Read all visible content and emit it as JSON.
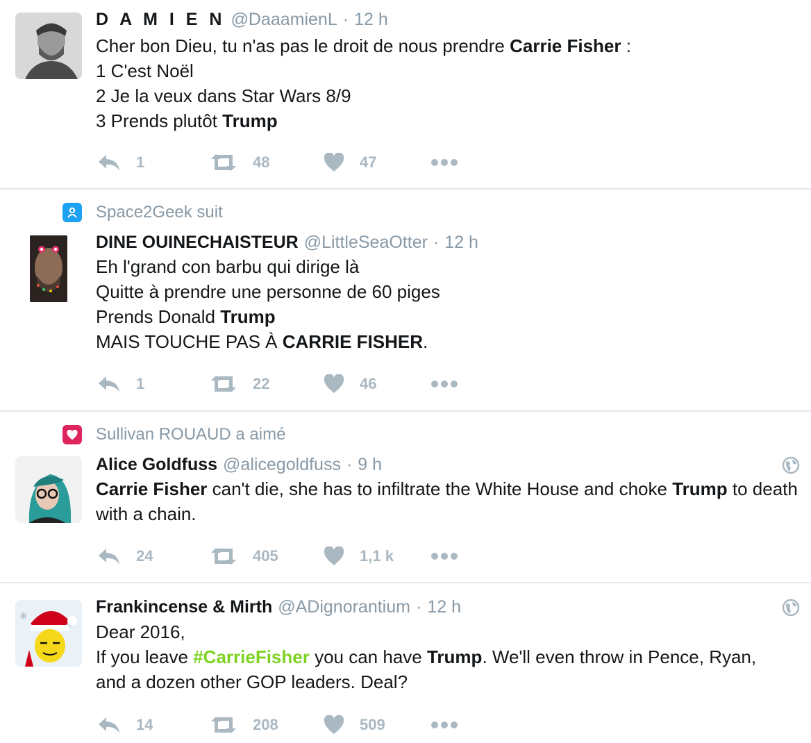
{
  "accent_color": "#1da1f2",
  "hashtag_color": "#7ed321",
  "tweets": [
    {
      "context": null,
      "author": {
        "name": "D A M I E N",
        "handle": "@DaaamienL",
        "time": "12 h",
        "avatar": "grayscale-man-portrait"
      },
      "body_lines": [
        [
          {
            "text": "Cher bon Dieu, tu n'as pas le droit de nous prendre "
          },
          {
            "text": "Carrie Fisher",
            "bold": true
          },
          {
            "text": " :"
          }
        ],
        [
          {
            "text": "1 C'est Noël"
          }
        ],
        [
          {
            "text": "2 Je la veux dans Star Wars 8/9"
          }
        ],
        [
          {
            "text": "3 Prends plutôt "
          },
          {
            "text": "Trump",
            "bold": true
          }
        ]
      ],
      "stats": {
        "replies": "1",
        "retweets": "48",
        "likes": "47"
      },
      "globe": false
    },
    {
      "context": {
        "icon": "follow-icon",
        "text": "Space2Geek suit"
      },
      "author": {
        "name": "DINE OUINECHAISTEUR",
        "handle": "@LittleSeaOtter",
        "time": "12 h",
        "avatar": "snapchat-filter-face"
      },
      "body_lines": [
        [
          {
            "text": "Eh l'grand con barbu qui dirige là"
          }
        ],
        [
          {
            "text": "Quitte à prendre une personne de 60 piges"
          }
        ],
        [
          {
            "text": "Prends Donald "
          },
          {
            "text": "Trump",
            "bold": true
          }
        ],
        [
          {
            "text": "MAIS TOUCHE PAS À "
          },
          {
            "text": "CARRIE FISHER",
            "bold": true
          },
          {
            "text": "."
          }
        ]
      ],
      "stats": {
        "replies": "1",
        "retweets": "22",
        "likes": "46"
      },
      "globe": false
    },
    {
      "context": {
        "icon": "heart-icon",
        "text": "Sullivan ROUAUD a aimé"
      },
      "author": {
        "name": "Alice Goldfuss",
        "handle": "@alicegoldfuss",
        "time": "9 h",
        "avatar": "teal-hair-glasses-portrait"
      },
      "body_lines": [
        [
          {
            "text": "Carrie Fisher",
            "bold": true
          },
          {
            "text": " can't die, she has to infiltrate the White House and choke "
          },
          {
            "text": "Trump",
            "bold": true
          },
          {
            "text": " to death with a chain."
          }
        ]
      ],
      "stats": {
        "replies": "24",
        "retweets": "405",
        "likes": "1,1 k"
      },
      "globe": true
    },
    {
      "context": null,
      "author": {
        "name": "Frankincense & Mirth",
        "handle": "@ADignorantium",
        "time": "12 h",
        "avatar": "santa-hat-cartoon"
      },
      "body_lines": [
        [
          {
            "text": "Dear 2016,"
          }
        ],
        [
          {
            "text": "If you leave "
          },
          {
            "text": "#CarrieFisher",
            "hashtag": true
          },
          {
            "text": " you can have "
          },
          {
            "text": "Trump",
            "bold": true
          },
          {
            "text": ". We'll even throw in Pence, Ryan, and a dozen other GOP leaders. Deal?"
          }
        ]
      ],
      "stats": {
        "replies": "14",
        "retweets": "208",
        "likes": "509"
      },
      "globe": true
    }
  ],
  "icons": {
    "reply": "reply-icon",
    "retweet": "retweet-icon",
    "like": "heart-icon",
    "more": "more-icon",
    "globe": "globe-icon"
  }
}
